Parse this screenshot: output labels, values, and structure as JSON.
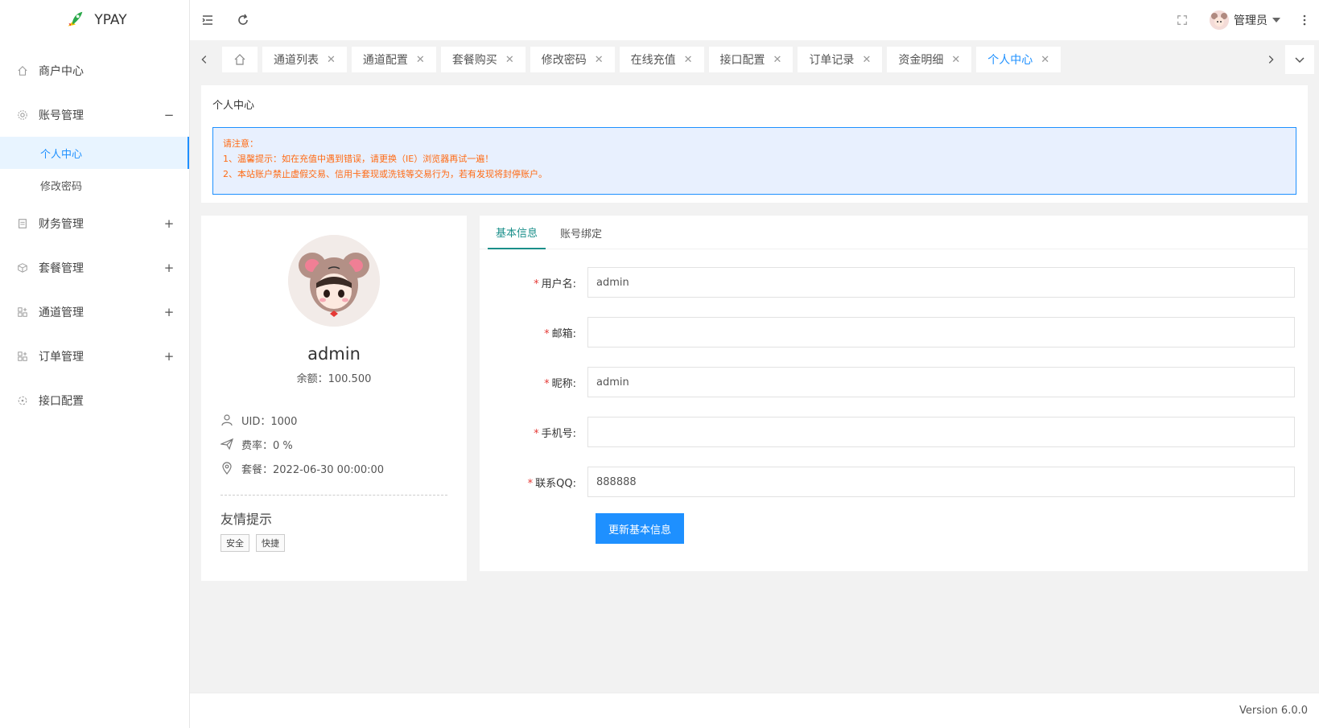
{
  "brand": {
    "name": "YPAY"
  },
  "sidebar": {
    "items": [
      {
        "label": "商户中心",
        "icon": "home-icon",
        "toggle": ""
      },
      {
        "label": "账号管理",
        "icon": "gear-icon",
        "toggle": "−",
        "expanded": true,
        "children": [
          {
            "label": "个人中心",
            "active": true
          },
          {
            "label": "修改密码",
            "active": false
          }
        ]
      },
      {
        "label": "财务管理",
        "icon": "finance-icon",
        "toggle": "+"
      },
      {
        "label": "套餐管理",
        "icon": "package-icon",
        "toggle": "+"
      },
      {
        "label": "通道管理",
        "icon": "grid-icon",
        "toggle": "+"
      },
      {
        "label": "订单管理",
        "icon": "grid-icon",
        "toggle": "+"
      },
      {
        "label": "接口配置",
        "icon": "plug-icon",
        "toggle": ""
      }
    ]
  },
  "header": {
    "user_name": "管理员"
  },
  "tabs": [
    {
      "label": "通道列表"
    },
    {
      "label": "通道配置"
    },
    {
      "label": "套餐购买"
    },
    {
      "label": "修改密码"
    },
    {
      "label": "在线充值"
    },
    {
      "label": "接口配置"
    },
    {
      "label": "订单记录"
    },
    {
      "label": "资金明细"
    },
    {
      "label": "个人中心",
      "active": true
    }
  ],
  "notice": {
    "title": "个人中心",
    "heading": "请注意：",
    "lines": [
      "1、温馨提示：如在充值中遇到错误，请更换（IE）浏览器再试一遍！",
      "2、本站账户禁止虚假交易、信用卡套现或洗钱等交易行为，若有发现将封停账户。"
    ]
  },
  "profile": {
    "name": "admin",
    "balance": "余额：100.500",
    "uid": "UID：1000",
    "rate": "费率：0 %",
    "package": "套餐：2022-06-30 00:00:00",
    "tips_title": "友情提示",
    "tags": [
      "安全",
      "快捷"
    ]
  },
  "form": {
    "tabs": [
      "基本信息",
      "账号绑定"
    ],
    "fields": [
      {
        "label": "用户名:",
        "value": "admin"
      },
      {
        "label": "邮箱:",
        "value": ""
      },
      {
        "label": "昵称:",
        "value": "admin"
      },
      {
        "label": "手机号:",
        "value": ""
      },
      {
        "label": "联系QQ:",
        "value": "888888"
      }
    ],
    "submit_label": "更新基本信息"
  },
  "footer": {
    "version": "Version 6.0.0"
  },
  "colors": {
    "accent": "#1e90ff",
    "warn": "#ff6a13",
    "tab_active": "#1a8f8a",
    "required": "#e53935"
  }
}
